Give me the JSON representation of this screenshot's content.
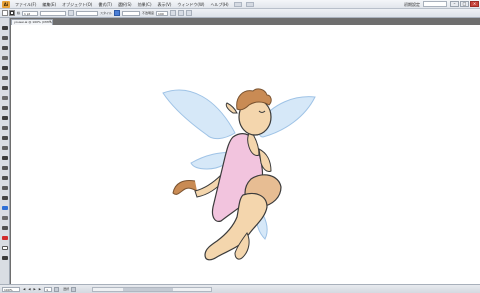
{
  "menubar": {
    "logo": "Ai",
    "items": [
      "ファイル(F)",
      "編集(E)",
      "オブジェクト(O)",
      "書式(T)",
      "選択(S)",
      "効果(C)",
      "表示(V)",
      "ウィンドウ(W)",
      "ヘルプ(H)"
    ],
    "workspace": "初期設定",
    "window_buttons": [
      "–",
      "□",
      "×"
    ]
  },
  "controlbar": {
    "stroke_label": "線",
    "stroke_width": "1 pt",
    "style_label": "スタイル",
    "opacity_label": "不透明度",
    "opacity_value": "100"
  },
  "document": {
    "tab_title": "yousei.ai @ 100% (CMYK/プレビュー)",
    "tab_close": "×"
  },
  "statusbar": {
    "zoom": "100%",
    "page": "1",
    "arrows": "◀ ◀ ▶ ▶",
    "mode": "選択"
  },
  "tools": {
    "colors": [
      "#3a3a3a",
      "#555555",
      "#4a4a4a",
      "#666666",
      "#3f3f3f",
      "#5a5a5a",
      "#444444",
      "#6a6a6a",
      "#505050",
      "#3c3c3c",
      "#5c5c5c",
      "#484848",
      "#606060",
      "#3a3a3a",
      "#555555",
      "#4d4d4d",
      "#5a5a5a",
      "#444444",
      "#2e6fd6",
      "#6a6a6a",
      "#505050",
      "#d12b2b",
      "#ffffff",
      "#3a3a3a"
    ]
  },
  "artwork": {
    "wing_color": "#d6e8f8",
    "wing_stroke": "#9fc3e6",
    "dress_color": "#f2c4de",
    "skin_color": "#f4d6ad",
    "skin_dark": "#e7bd93",
    "hair_color": "#c98b54",
    "tail_color": "#c98b54",
    "outline": "#3b3b3b"
  }
}
